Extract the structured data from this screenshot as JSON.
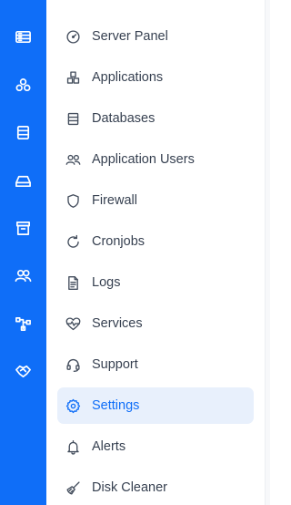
{
  "rail": {
    "items": [
      {
        "icon": "server-panel-icon"
      },
      {
        "icon": "applications-icon"
      },
      {
        "icon": "databases-icon"
      },
      {
        "icon": "drive-icon"
      },
      {
        "icon": "archive-icon"
      },
      {
        "icon": "users-icon"
      },
      {
        "icon": "network-icon"
      },
      {
        "icon": "handshake-icon"
      }
    ]
  },
  "menu": {
    "items": [
      {
        "label": "Server Panel",
        "icon": "gauge-icon"
      },
      {
        "label": "Applications",
        "icon": "boxes-icon"
      },
      {
        "label": "Databases",
        "icon": "database-icon"
      },
      {
        "label": "Application Users",
        "icon": "users-icon"
      },
      {
        "label": "Firewall",
        "icon": "shield-icon"
      },
      {
        "label": "Cronjobs",
        "icon": "refresh-icon"
      },
      {
        "label": "Logs",
        "icon": "file-text-icon"
      },
      {
        "label": "Services",
        "icon": "heart-pulse-icon"
      },
      {
        "label": "Support",
        "icon": "headset-icon"
      },
      {
        "label": "Settings",
        "icon": "gear-icon"
      },
      {
        "label": "Alerts",
        "icon": "bell-icon"
      },
      {
        "label": "Disk Cleaner",
        "icon": "broom-icon"
      }
    ],
    "active": "Settings"
  },
  "colors": {
    "rail": "#0f6ef8",
    "active_bg": "#e8f0fc",
    "active_text": "#0f6ef8",
    "text": "#374151"
  }
}
